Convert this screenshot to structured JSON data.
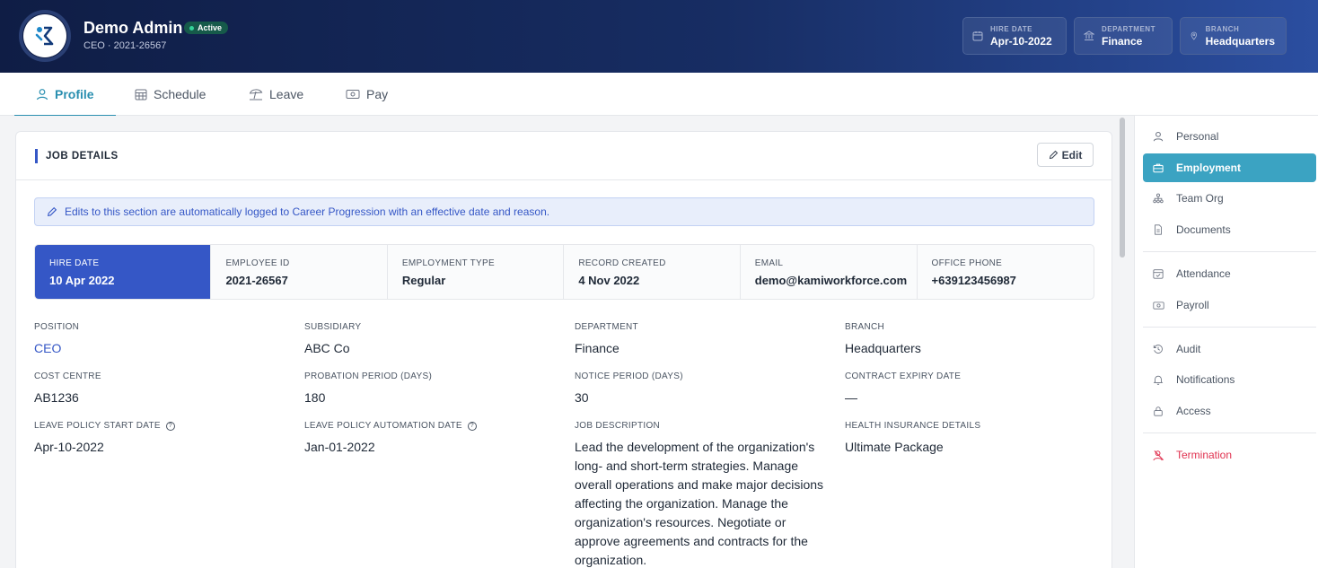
{
  "header": {
    "name": "Demo Admin",
    "status": "Active",
    "subtitle": "CEO · 2021-26567",
    "chips": [
      {
        "label": "HIRE DATE",
        "value": "Apr-10-2022",
        "icon": "calendar-icon"
      },
      {
        "label": "DEPARTMENT",
        "value": "Finance",
        "icon": "bank-icon"
      },
      {
        "label": "BRANCH",
        "value": "Headquarters",
        "icon": "location-pin-icon"
      }
    ]
  },
  "tabs": [
    {
      "label": "Profile",
      "icon": "user-icon",
      "active": true
    },
    {
      "label": "Schedule",
      "icon": "calendar-grid-icon"
    },
    {
      "label": "Leave",
      "icon": "beach-umbrella-icon"
    },
    {
      "label": "Pay",
      "icon": "cash-icon"
    }
  ],
  "card": {
    "title": "JOB DETAILS",
    "edit_label": "Edit",
    "notice": "Edits to this section are automatically logged to Career Progression with an effective date and reason."
  },
  "stats": [
    {
      "label": "HIRE DATE",
      "value": "10 Apr 2022"
    },
    {
      "label": "EMPLOYEE ID",
      "value": "2021-26567"
    },
    {
      "label": "EMPLOYMENT TYPE",
      "value": "Regular"
    },
    {
      "label": "RECORD CREATED",
      "value": "4 Nov 2022"
    },
    {
      "label": "EMAIL",
      "value": "demo@kamiworkforce.com"
    },
    {
      "label": "OFFICE PHONE",
      "value": "+639123456987"
    }
  ],
  "fields": [
    {
      "label": "POSITION",
      "value": "CEO"
    },
    {
      "label": "SUBSIDIARY",
      "value": "ABC Co"
    },
    {
      "label": "DEPARTMENT",
      "value": "Finance"
    },
    {
      "label": "BRANCH",
      "value": "Headquarters"
    },
    {
      "label": "COST CENTRE",
      "value": "AB1236"
    },
    {
      "label": "PROBATION PERIOD (DAYS)",
      "value": "180"
    },
    {
      "label": "NOTICE PERIOD (DAYS)",
      "value": "30"
    },
    {
      "label": "CONTRACT EXPIRY DATE",
      "value": "—"
    },
    {
      "label": "LEAVE POLICY START DATE",
      "value": "Apr-10-2022"
    },
    {
      "label": "LEAVE POLICY AUTOMATION DATE",
      "value": "Jan-01-2022"
    },
    {
      "label": "JOB DESCRIPTION",
      "value": "Lead the development of the organization's long- and short-term strategies. Manage overall operations and make major decisions affecting the organization. Manage the organization's resources. Negotiate or approve agreements and contracts for the organization."
    },
    {
      "label": "HEALTH INSURANCE DETAILS",
      "value": "Ultimate Package"
    }
  ],
  "sidenav": [
    {
      "label": "Personal",
      "icon": "user-icon"
    },
    {
      "label": "Employment",
      "icon": "briefcase-icon",
      "active": true
    },
    {
      "label": "Team Org",
      "icon": "org-chart-icon"
    },
    {
      "label": "Documents",
      "icon": "document-icon"
    },
    {
      "label": "Attendance",
      "icon": "calendar-check-icon"
    },
    {
      "label": "Payroll",
      "icon": "cash-icon"
    },
    {
      "label": "Audit",
      "icon": "history-icon"
    },
    {
      "label": "Notifications",
      "icon": "bell-icon"
    },
    {
      "label": "Access",
      "icon": "lock-icon"
    },
    {
      "label": "Termination",
      "icon": "user-remove-icon",
      "danger": true
    }
  ]
}
